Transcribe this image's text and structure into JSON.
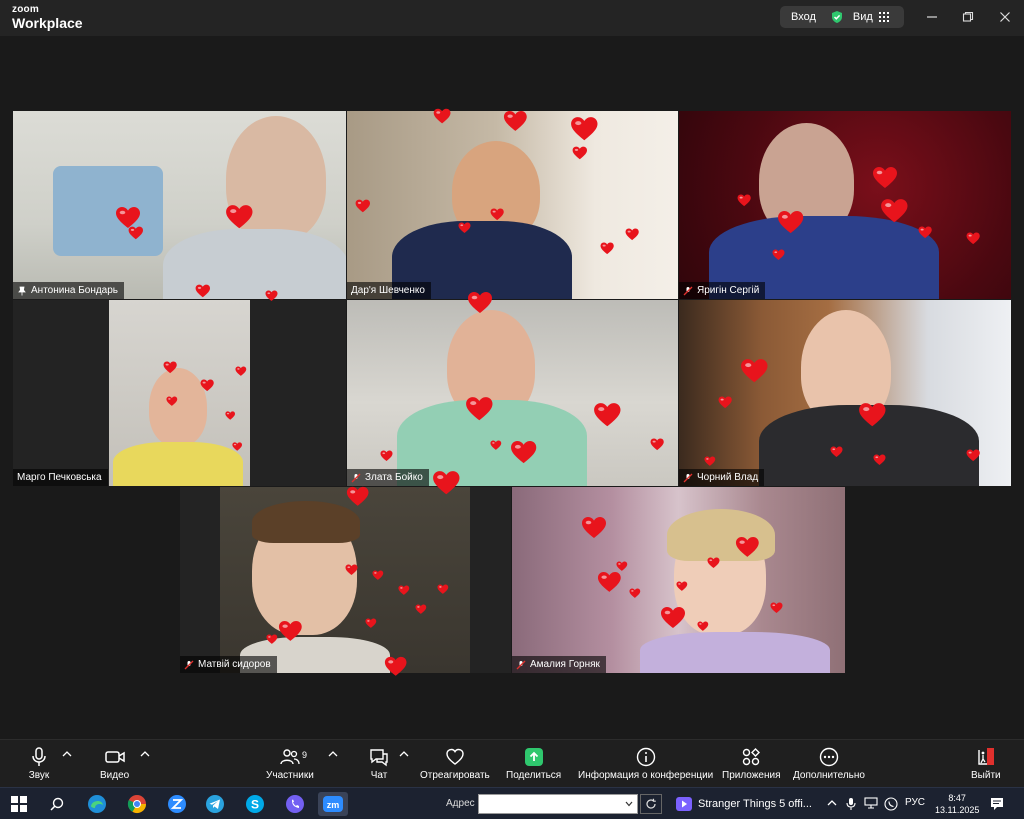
{
  "app": {
    "logo_line1": "zoom",
    "logo_line2": "Workplace",
    "enter_label": "Вход",
    "view_label": "Вид"
  },
  "participants": [
    {
      "name": "Антонина Бондарь",
      "icon": "pin-icon",
      "active": true
    },
    {
      "name": "Дар'я Шевченко",
      "icon": "",
      "active": false
    },
    {
      "name": "Яригін Сергій",
      "icon": "mic-muted-icon",
      "active": false
    },
    {
      "name": "Марго Печковська",
      "icon": "",
      "active": false
    },
    {
      "name": "Злата Бойко",
      "icon": "mic-muted-icon",
      "active": false
    },
    {
      "name": "Чорний Влад",
      "icon": "mic-muted-icon",
      "active": false
    },
    {
      "name": "Матвій сидоров",
      "icon": "mic-muted-icon",
      "active": false
    },
    {
      "name": "Амалия Горняк",
      "icon": "mic-muted-icon",
      "active": false
    }
  ],
  "toolbar": {
    "audio_label": "Звук",
    "video_label": "Видео",
    "participants_label": "Участники",
    "participants_count": "9",
    "chat_label": "Чат",
    "react_label": "Отреагировать",
    "share_label": "Поделиться",
    "info_label": "Информация о конференции",
    "apps_label": "Приложения",
    "more_label": "Дополнительно",
    "leave_label": "Выйти"
  },
  "taskbar": {
    "address_label": "Адрес",
    "address_value": "",
    "media_title": "Stranger Things 5 offi...",
    "language": "РУС",
    "time": "8:47",
    "date": "13.11.2025"
  },
  "colors": {
    "active_speaker": "#2fc76e",
    "share_green": "#2fc76e",
    "leave_red": "#e0302d",
    "heart_red": "#e8141c",
    "shield_green": "#2fc76e"
  }
}
